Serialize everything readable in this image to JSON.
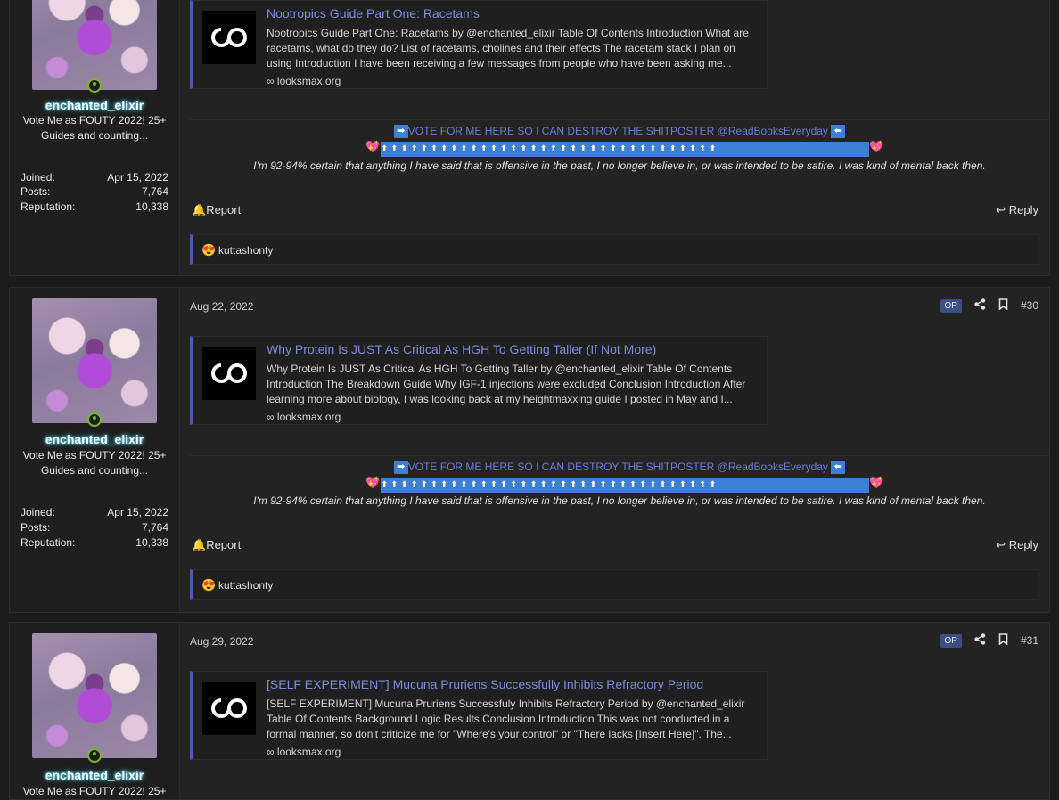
{
  "posts": [
    {
      "author": "enchanted_elixir",
      "user_title": "Vote Me as FOUTY 2022! 25+ Guides and counting...",
      "stats": [
        {
          "label": "Joined:",
          "value": "Apr 15, 2022"
        },
        {
          "label": "Posts:",
          "value": "7,764"
        },
        {
          "label": "Reputation:",
          "value": "10,338"
        }
      ],
      "embed": {
        "title": "Nootropics Guide Part One: Racetams",
        "description": "Nootropics Guide Part One: Racetams by @enchanted_elixir Table Of Contents Introduction What are racetams, what do they do? List of racetams, cholines and their effects The racetam stack I plan on using Introduction I have been receiving a few messages from people who have been asking me...",
        "source": "looksmax.org"
      },
      "signature": {
        "vote_text": "VOTE FOR ME HERE SO I CAN DESTROY THE SHITPOSTER @ReadBooksEveryday",
        "quote": "I'm 92-94% certain that anything I have said that is offensive in the past, I no longer believe in, or was intended to be satire. I was kind of mental back then."
      },
      "report_label": "Report",
      "reply_label": "Reply",
      "reaction_user": "kuttashonty"
    },
    {
      "author": "enchanted_elixir",
      "user_title": "Vote Me as FOUTY 2022! 25+ Guides and counting...",
      "date": "Aug 22, 2022",
      "op_badge": "OP",
      "post_number": "#30",
      "stats": [
        {
          "label": "Joined:",
          "value": "Apr 15, 2022"
        },
        {
          "label": "Posts:",
          "value": "7,764"
        },
        {
          "label": "Reputation:",
          "value": "10,338"
        }
      ],
      "embed": {
        "title": "Why Protein Is JUST As Critical As HGH To Getting Taller (If Not More)",
        "description": "Why Protein Is JUST As Critical As HGH To Getting Taller by @enchanted_elixir Table Of Contents Introduction The Breakdown Guide Why IGF-1 injections were excluded Conclusion Introduction After learning more about biology, I was looking back at my heightmaxxing guide I posted in May and I...",
        "source": "looksmax.org"
      },
      "signature": {
        "vote_text": "VOTE FOR ME HERE SO I CAN DESTROY THE SHITPOSTER @ReadBooksEveryday",
        "quote": "I'm 92-94% certain that anything I have said that is offensive in the past, I no longer believe in, or was intended to be satire. I was kind of mental back then."
      },
      "report_label": "Report",
      "reply_label": "Reply",
      "reaction_user": "kuttashonty"
    },
    {
      "author": "enchanted_elixir",
      "user_title": "Vote Me as FOUTY 2022! 25+",
      "date": "Aug 29, 2022",
      "op_badge": "OP",
      "post_number": "#31",
      "embed": {
        "title": "[SELF EXPERIMENT] Mucuna Pruriens Successfully Inhibits Refractory Period",
        "description": "[SELF EXPERIMENT] Mucuna Pruriens Successfuly Inhibits Refractory Period by @enchanted_elixir Table Of Contents Background Logic Results Conclusion Introduction This was not conducted in a formal manner, so don't criticize me for \"Where's your control\" or \"There lacks [Insert Here]\". The...",
        "source": "looksmax.org"
      }
    }
  ],
  "icons": {
    "logo": "looksmax-infinity-logo",
    "share": "share-icon",
    "bookmark": "bookmark-icon",
    "report": "bell-icon",
    "reply": "reply-arrow-icon",
    "reaction": "heart-eyes-emoji"
  },
  "colors": {
    "accent": "#4a5db3",
    "link": "#7e8cde",
    "username_glow": "#4fd6ff",
    "online": "#7bb52c",
    "op_badge": "#3b4f86"
  }
}
